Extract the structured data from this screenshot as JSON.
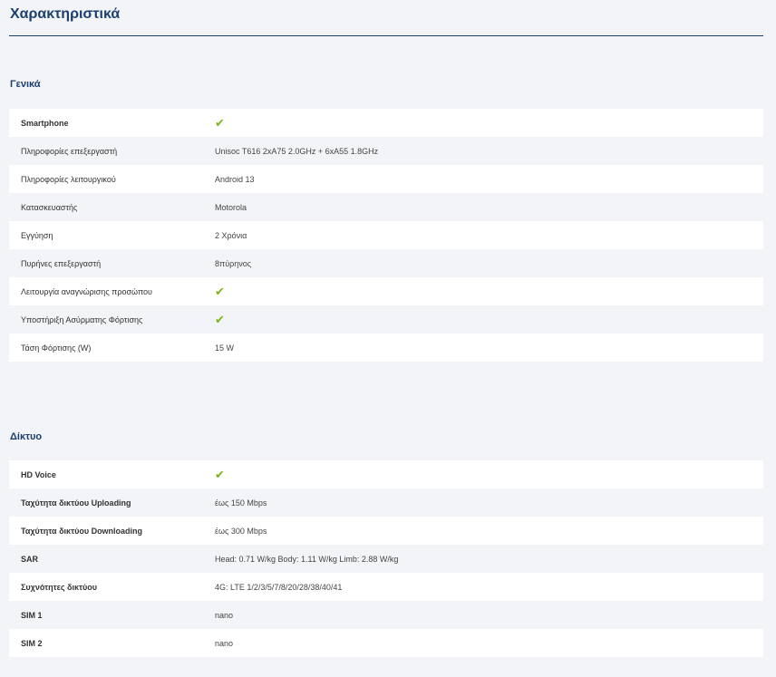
{
  "page_title": "Χαρακτηριστικά",
  "sections": [
    {
      "title": "Γενικά",
      "rows": [
        {
          "label": "Smartphone",
          "value": "",
          "check": true
        },
        {
          "label": "Πληροφορίες επεξεργαστή",
          "value": "Unisoc T616 2xA75 2.0GHz + 6xA55 1.8GHz",
          "check": false
        },
        {
          "label": "Πληροφορίες λειτουργικού",
          "value": "Android 13",
          "check": false
        },
        {
          "label": "Κατασκευαστής",
          "value": "Motorola",
          "check": false
        },
        {
          "label": "Εγγύηση",
          "value": "2 Χρόνια",
          "check": false
        },
        {
          "label": "Πυρήνες επεξεργαστή",
          "value": "8πύρηνος",
          "check": false
        },
        {
          "label": "Λειτουργία αναγνώρισης προσώπου",
          "value": "",
          "check": true
        },
        {
          "label": "Υποστήριξη Ασύρματης Φόρτισης",
          "value": "",
          "check": true
        },
        {
          "label": "Τάση Φόρτισης (W)",
          "value": "15 W",
          "check": false
        }
      ]
    },
    {
      "title": "Δίκτυο",
      "rows": [
        {
          "label": "HD Voice",
          "value": "",
          "check": true
        },
        {
          "label": "Ταχύτητα δικτύου Uploading",
          "value": "έως 150 Mbps",
          "check": false
        },
        {
          "label": "Ταχύτητα δικτύου Downloading",
          "value": "έως 300 Mbps",
          "check": false
        },
        {
          "label": "SAR",
          "value": "Head: 0.71 W/kg Body: 1.11 W/kg Limb: 2.88 W/kg",
          "check": false
        },
        {
          "label": "Συχνότητες δικτύου",
          "value": "4G: LTE 1/2/3/5/7/8/20/28/38/40/41",
          "check": false
        },
        {
          "label": "SIM 1",
          "value": "nano",
          "check": false
        },
        {
          "label": "SIM 2",
          "value": "nano",
          "check": false
        }
      ]
    }
  ],
  "check_glyph": "✔",
  "colors": {
    "accent": "#1d3f6e",
    "check": "#7cb518"
  }
}
